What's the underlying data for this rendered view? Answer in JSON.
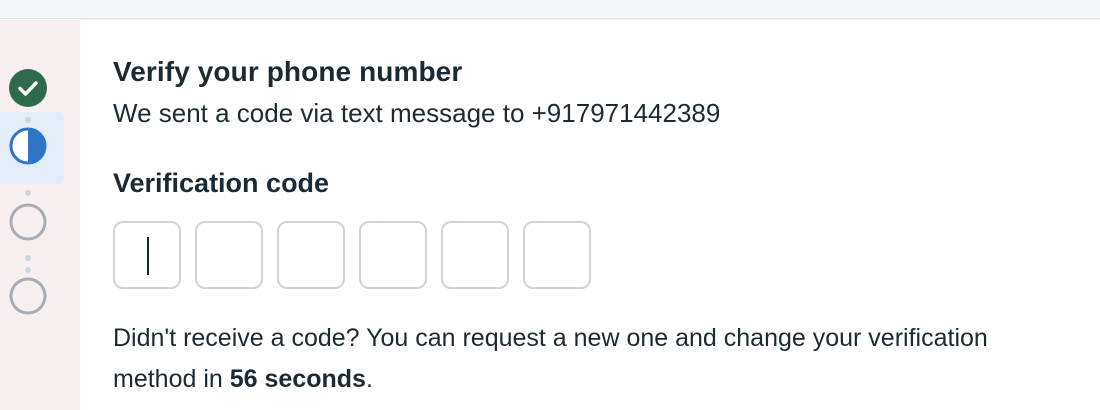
{
  "stepper": {
    "steps": [
      {
        "state": "completed",
        "icon": "check-circle-icon"
      },
      {
        "state": "current",
        "icon": "half-circle-icon"
      },
      {
        "state": "pending",
        "icon": "empty-circle-icon"
      },
      {
        "state": "pending",
        "icon": "empty-circle-icon"
      }
    ]
  },
  "colors": {
    "completed": "#2e6b4d",
    "current": "#2f74c7",
    "pending": "#a7adb4"
  },
  "verify": {
    "title": "Verify your phone number",
    "subtitle": "We sent a code via text message to +917971442389",
    "code_label": "Verification code",
    "code_digits": [
      "",
      "",
      "",
      "",
      "",
      ""
    ],
    "help_prefix": "Didn't receive a code? You can request a new one and change your verification method in ",
    "countdown": "56 seconds",
    "help_suffix": "."
  }
}
